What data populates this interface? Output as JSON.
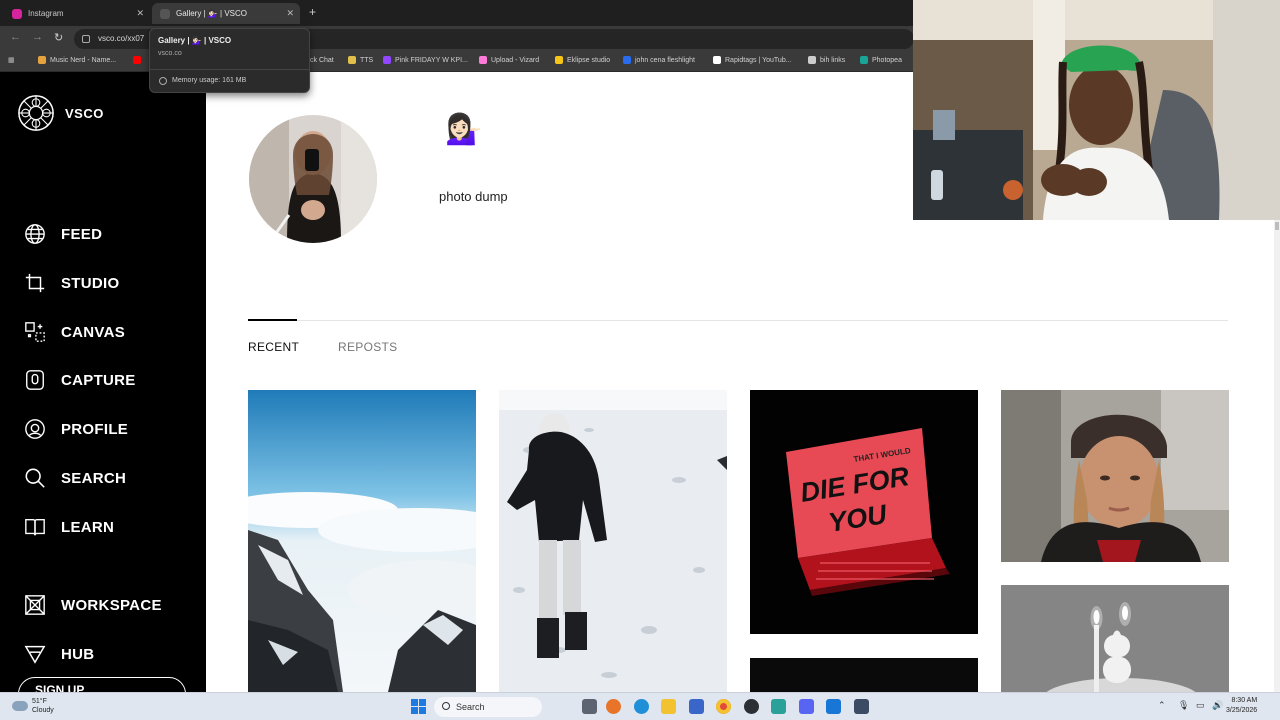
{
  "browser": {
    "tabs": [
      {
        "title": "Instagram",
        "favicon_color": "#d6249f"
      },
      {
        "title": "Gallery | 💁🏻‍♀️ | VSCO",
        "favicon_color": "#555555"
      }
    ],
    "url": "vsco.co/xx07",
    "bookmarks": [
      {
        "label": "Music Nerd - Name...",
        "color": "#e6a23c"
      },
      {
        "label": "ck Chat",
        "color": "#9b59b6"
      },
      {
        "label": "TTS",
        "color": "#e0c04a"
      },
      {
        "label": "Pink FRIDAYY W KPI...",
        "color": "#9146ff"
      },
      {
        "label": "Upload - Vizard",
        "color": "#ff7ad9"
      },
      {
        "label": "Eklipse studio",
        "color": "#f5c518"
      },
      {
        "label": "john cena fleshlight",
        "color": "#2a6cf0"
      },
      {
        "label": "Rapidtags | YouTub...",
        "color": "#ffffff"
      },
      {
        "label": "bih links",
        "color": "#cccccc"
      },
      {
        "label": "Photopea",
        "color": "#18a497"
      }
    ],
    "hovercard": {
      "title": "Gallery | 💁🏻‍♀️ | VSCO",
      "domain": "vsco.co",
      "memory": "Memory usage: 161 MB"
    }
  },
  "sidebar": {
    "brand": "VSCO",
    "items": [
      {
        "label": "FEED",
        "icon": "globe-icon"
      },
      {
        "label": "STUDIO",
        "icon": "crop-icon"
      },
      {
        "label": "CANVAS",
        "icon": "canvas-icon"
      },
      {
        "label": "CAPTURE",
        "icon": "camera-icon"
      },
      {
        "label": "PROFILE",
        "icon": "profile-icon"
      },
      {
        "label": "SEARCH",
        "icon": "search-icon"
      },
      {
        "label": "LEARN",
        "icon": "book-icon"
      },
      {
        "label": "WORKSPACE",
        "icon": "workspace-icon"
      },
      {
        "label": "HUB",
        "icon": "hub-icon"
      }
    ],
    "signup": "SIGN UP"
  },
  "profile": {
    "emoji": "💁🏻‍♀️",
    "bio": "photo dump",
    "tabs": [
      "RECENT",
      "REPOSTS"
    ]
  },
  "gallery": [
    {
      "name": "mountain-clouds-photo"
    },
    {
      "name": "snow-walker-photo"
    },
    {
      "name": "die-for-you-laptop-photo",
      "text": "THAT I WOULD DIE FOR YOU"
    },
    {
      "name": "selfie-beanie-photo"
    },
    {
      "name": "dark-photo"
    },
    {
      "name": "birthday-candle-photo"
    }
  ],
  "taskbar": {
    "weather_temp": "51°F",
    "weather_desc": "Cloudy",
    "search": "Search",
    "time": "8:30 AM",
    "date": "3/25/2026"
  }
}
